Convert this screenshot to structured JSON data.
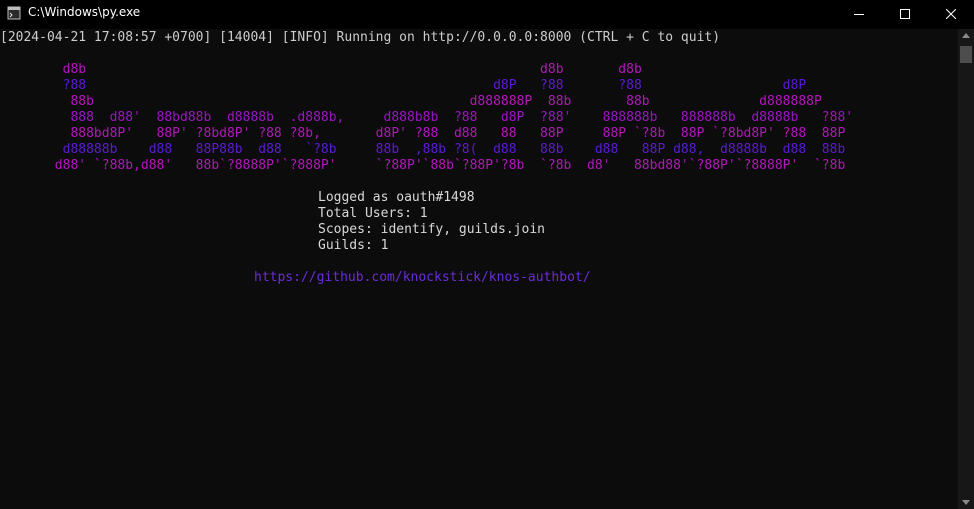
{
  "window": {
    "title": "C:\\Windows\\py.exe",
    "icon": "python-icon"
  },
  "controls": {
    "minimize": "minimize-icon",
    "maximize": "maximize-icon",
    "close": "close-icon"
  },
  "console": {
    "log": "[2024-04-21 17:08:57 +0700] [14004] [INFO] Running on http://0.0.0.0:8000 (CTRL + C to quit)",
    "art": [
      "        d8b                                                          d8b       d8b",
      "        ?88                                                    d8P   ?88       ?88                  d8P",
      "         88b                                                d888888P  88b       88b              d888888P",
      "         888  d88'  88bd88b  d8888b  .d888b,     d888b8b  ?88   d8P  ?88'    888888b   888888b  d8888b   ?88'",
      "         888bd8P'   88P' ?8bd8P' ?88 ?8b,       d8P' ?88  d88   88   88P     88P `?8b  88P `?8bd8P' ?88  88P",
      "        d88888b    d88   88P88b  d88   `?8b     88b  ,88b ?8(  d88   88b    d88   88P d88,  d8888b  d88  88b",
      "       d88' `?88b,d88'   88b`?8888P'`?888P'     `?88P'`88b`?88P'?8b  `?8b  d8'   88bd88'`?88P'`?8888P'  `?8b"
    ],
    "info": [
      "Logged as oauth#1498",
      "Total Users: 1",
      "Scopes: identify, guilds.join",
      "Guilds: 1"
    ],
    "link": "https://github.com/knockstick/knos-authbot/"
  },
  "colors": {
    "background": "#0c0c0c",
    "text": "#cccccc",
    "art_purple": "#b018b9",
    "art_violet": "#5a1bd6",
    "link": "#6a2cd9"
  }
}
